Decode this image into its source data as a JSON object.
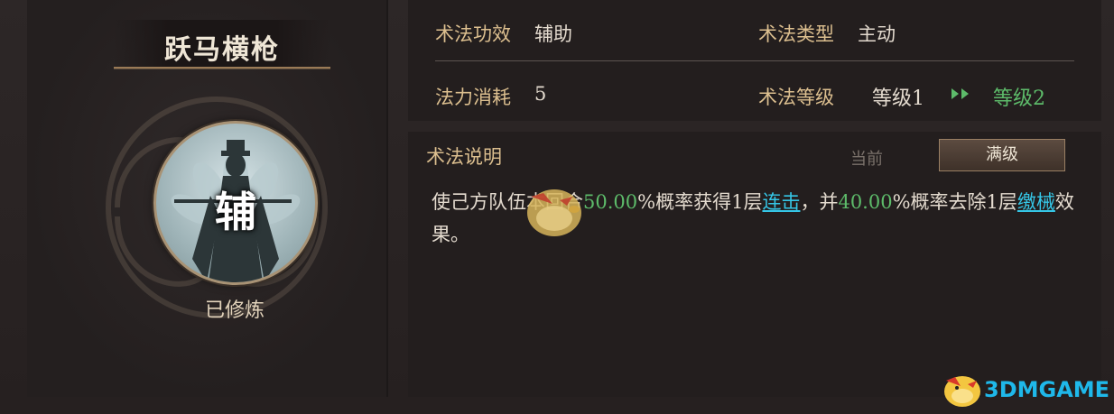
{
  "tactic": {
    "name": "跃马横枪",
    "portrait_char": "辅",
    "status": "已修炼"
  },
  "info": {
    "effect_label": "术法功效",
    "effect_value": "辅助",
    "type_label": "术法类型",
    "type_value": "主动",
    "cost_label": "法力消耗",
    "cost_value": "5",
    "level_label": "术法等级",
    "level_current": "等级1",
    "level_next": "等级2"
  },
  "description": {
    "title": "术法说明",
    "tab_current": "当前",
    "tab_max": "满级",
    "text_1": "使己方队伍本回合",
    "value_1": "50.00",
    "text_2": "%概率获得1层",
    "link_1": "连击",
    "text_3": "，并",
    "value_2": "40.00",
    "text_4": "%概率去除1层",
    "link_2": "缴械",
    "text_5": "效果。"
  },
  "watermark": {
    "text": "3DMGAME"
  },
  "colors": {
    "label_gold": "#dcbf8f",
    "value_green": "#5dbb6a",
    "link_cyan": "#35c6e6",
    "panel_bg": "#231e1e"
  }
}
